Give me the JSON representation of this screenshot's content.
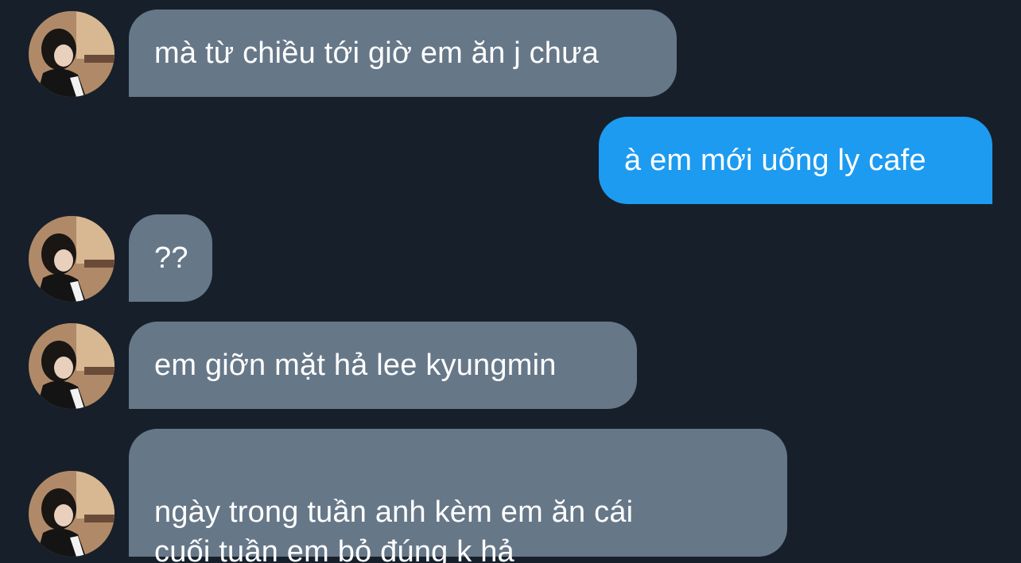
{
  "conversation": {
    "messages": [
      {
        "direction": "incoming",
        "text": "mà từ chiều tới giờ em ăn j chưa"
      },
      {
        "direction": "outgoing",
        "text": "à em mới uống ly cafe"
      },
      {
        "direction": "incoming",
        "text": "??"
      },
      {
        "direction": "incoming",
        "text": "em giỡn mặt hả lee kyungmin"
      },
      {
        "direction": "incoming",
        "text": "ngày trong tuần anh kèm em ăn cái\ncuối tuần em bỏ đúng k hả"
      }
    ]
  },
  "colors": {
    "background": "#17202a",
    "incoming_bubble": "#667788",
    "outgoing_bubble": "#1d9bf0",
    "text": "#ffffff"
  },
  "icons": {
    "avatar": "contact-avatar"
  }
}
